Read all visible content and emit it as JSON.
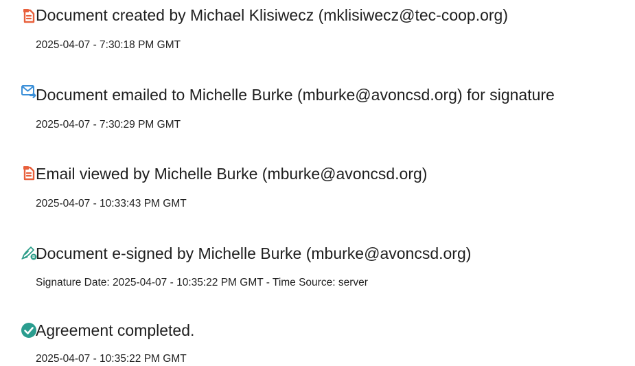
{
  "events": [
    {
      "icon": "document-created-icon",
      "title": "Document created by Michael Klisiwecz (mklisiwecz@tec-coop.org)",
      "detail": "2025-04-07 - 7:30:18 PM GMT"
    },
    {
      "icon": "email-sent-icon",
      "title": "Document emailed to Michelle Burke (mburke@avoncsd.org) for signature",
      "detail": "2025-04-07 - 7:30:29 PM GMT"
    },
    {
      "icon": "email-viewed-icon",
      "title": "Email viewed by Michelle Burke (mburke@avoncsd.org)",
      "detail": "2025-04-07 - 10:33:43 PM GMT"
    },
    {
      "icon": "e-signed-pen-icon",
      "title": "Document e-signed by Michelle Burke (mburke@avoncsd.org)",
      "detail": "Signature Date: 2025-04-07 - 10:35:22 PM GMT - Time Source: server"
    },
    {
      "icon": "checkmark-circle-icon",
      "title": "Agreement completed.",
      "detail": "2025-04-07 - 10:35:22 PM GMT"
    }
  ],
  "colors": {
    "document_icon": "#e8603c",
    "email_icon": "#3a8fd8",
    "pen_icon": "#2e9e8a",
    "check_icon": "#2a9d8f"
  }
}
